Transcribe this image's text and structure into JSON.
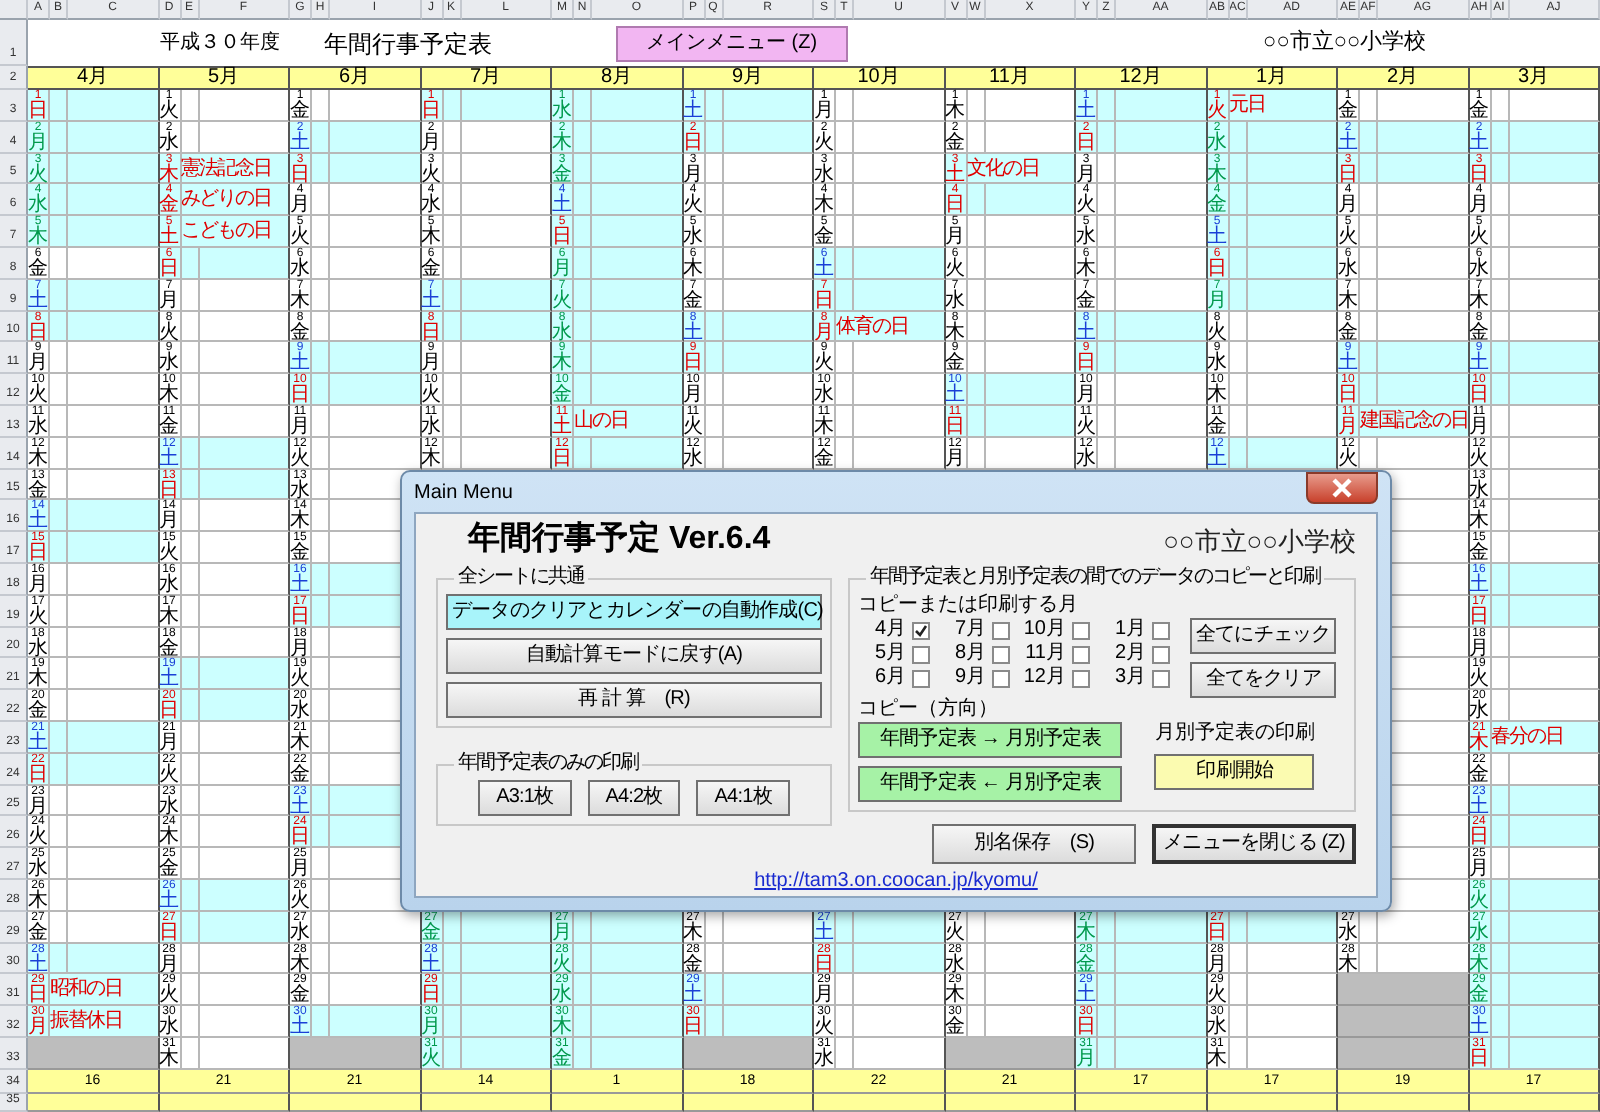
{
  "sheet": {
    "column_letters": [
      "A",
      "B",
      "C",
      "D",
      "E",
      "F",
      "G",
      "H",
      "I",
      "J",
      "K",
      "L",
      "M",
      "N",
      "O",
      "P",
      "Q",
      "R",
      "S",
      "T",
      "U",
      "V",
      "W",
      "X",
      "Y",
      "Z",
      "AA",
      "AB",
      "AC",
      "AD",
      "AE",
      "AF",
      "AG",
      "AH",
      "AI",
      "AJ"
    ],
    "row_numbers": [
      "1",
      "2",
      "3",
      "4",
      "5",
      "6",
      "7",
      "8",
      "9",
      "10",
      "11",
      "12",
      "13",
      "14",
      "15",
      "16",
      "17",
      "18",
      "19",
      "20",
      "21",
      "22",
      "23",
      "24",
      "25",
      "26",
      "27",
      "28",
      "29",
      "30",
      "31",
      "32",
      "33",
      "34",
      "35"
    ],
    "title_row": {
      "fiscal_year": "平成３０年度",
      "title": "年間行事予定表",
      "menu_button": "メインメニュー (Z)",
      "school": "○○市立○○小学校"
    },
    "months": [
      {
        "label": "4月",
        "total": "16",
        "days": [
          {
            "d": "1",
            "w": "日",
            "kind": "sun"
          },
          {
            "d": "2",
            "w": "月",
            "kind": "vac"
          },
          {
            "d": "3",
            "w": "火",
            "kind": "vac"
          },
          {
            "d": "4",
            "w": "水",
            "kind": "vac"
          },
          {
            "d": "5",
            "w": "木",
            "kind": "vac"
          },
          {
            "d": "6",
            "w": "金",
            "kind": "wd"
          },
          {
            "d": "7",
            "w": "土",
            "kind": "sat"
          },
          {
            "d": "8",
            "w": "日",
            "kind": "sun"
          },
          {
            "d": "9",
            "w": "月",
            "kind": "wd"
          },
          {
            "d": "10",
            "w": "火",
            "kind": "wd"
          },
          {
            "d": "11",
            "w": "水",
            "kind": "wd"
          },
          {
            "d": "12",
            "w": "木",
            "kind": "wd"
          },
          {
            "d": "13",
            "w": "金",
            "kind": "wd"
          },
          {
            "d": "14",
            "w": "土",
            "kind": "sat"
          },
          {
            "d": "15",
            "w": "日",
            "kind": "sun"
          },
          {
            "d": "16",
            "w": "月",
            "kind": "wd"
          },
          {
            "d": "17",
            "w": "火",
            "kind": "wd"
          },
          {
            "d": "18",
            "w": "水",
            "kind": "wd"
          },
          {
            "d": "19",
            "w": "木",
            "kind": "wd"
          },
          {
            "d": "20",
            "w": "金",
            "kind": "wd"
          },
          {
            "d": "21",
            "w": "土",
            "kind": "sat"
          },
          {
            "d": "22",
            "w": "日",
            "kind": "sun"
          },
          {
            "d": "23",
            "w": "月",
            "kind": "wd"
          },
          {
            "d": "24",
            "w": "火",
            "kind": "wd"
          },
          {
            "d": "25",
            "w": "水",
            "kind": "wd"
          },
          {
            "d": "26",
            "w": "木",
            "kind": "wd"
          },
          {
            "d": "27",
            "w": "金",
            "kind": "wd"
          },
          {
            "d": "28",
            "w": "土",
            "kind": "sat"
          },
          {
            "d": "29",
            "w": "日",
            "kind": "hol",
            "ev": "昭和の日"
          },
          {
            "d": "30",
            "w": "月",
            "kind": "hol",
            "ev": "振替休日"
          }
        ]
      },
      {
        "label": "5月",
        "total": "21",
        "days": [
          {
            "d": "1",
            "w": "火",
            "kind": "wd"
          },
          {
            "d": "2",
            "w": "水",
            "kind": "wd"
          },
          {
            "d": "3",
            "w": "木",
            "kind": "hol",
            "ev": "憲法記念日"
          },
          {
            "d": "4",
            "w": "金",
            "kind": "hol",
            "ev": "みどりの日"
          },
          {
            "d": "5",
            "w": "土",
            "kind": "hol",
            "ev": "こどもの日"
          },
          {
            "d": "6",
            "w": "日",
            "kind": "sun"
          },
          {
            "d": "7",
            "w": "月",
            "kind": "wd"
          },
          {
            "d": "8",
            "w": "火",
            "kind": "wd"
          },
          {
            "d": "9",
            "w": "水",
            "kind": "wd"
          },
          {
            "d": "10",
            "w": "木",
            "kind": "wd"
          },
          {
            "d": "11",
            "w": "金",
            "kind": "wd"
          },
          {
            "d": "12",
            "w": "土",
            "kind": "sat"
          },
          {
            "d": "13",
            "w": "日",
            "kind": "sun"
          },
          {
            "d": "14",
            "w": "月",
            "kind": "wd"
          },
          {
            "d": "15",
            "w": "火",
            "kind": "wd"
          },
          {
            "d": "16",
            "w": "水",
            "kind": "wd"
          },
          {
            "d": "17",
            "w": "木",
            "kind": "wd"
          },
          {
            "d": "18",
            "w": "金",
            "kind": "wd"
          },
          {
            "d": "19",
            "w": "土",
            "kind": "sat"
          },
          {
            "d": "20",
            "w": "日",
            "kind": "sun"
          },
          {
            "d": "21",
            "w": "月",
            "kind": "wd"
          },
          {
            "d": "22",
            "w": "火",
            "kind": "wd"
          },
          {
            "d": "23",
            "w": "水",
            "kind": "wd"
          },
          {
            "d": "24",
            "w": "木",
            "kind": "wd"
          },
          {
            "d": "25",
            "w": "金",
            "kind": "wd"
          },
          {
            "d": "26",
            "w": "土",
            "kind": "sat"
          },
          {
            "d": "27",
            "w": "日",
            "kind": "sun"
          },
          {
            "d": "28",
            "w": "月",
            "kind": "wd"
          },
          {
            "d": "29",
            "w": "火",
            "kind": "wd"
          },
          {
            "d": "30",
            "w": "水",
            "kind": "wd"
          },
          {
            "d": "31",
            "w": "木",
            "kind": "wd"
          }
        ]
      },
      {
        "label": "6月",
        "total": "21",
        "days": [
          {
            "d": "1",
            "w": "金",
            "kind": "wd"
          },
          {
            "d": "2",
            "w": "土",
            "kind": "sat"
          },
          {
            "d": "3",
            "w": "日",
            "kind": "sun"
          },
          {
            "d": "4",
            "w": "月",
            "kind": "wd"
          },
          {
            "d": "5",
            "w": "火",
            "kind": "wd"
          },
          {
            "d": "6",
            "w": "水",
            "kind": "wd"
          },
          {
            "d": "7",
            "w": "木",
            "kind": "wd"
          },
          {
            "d": "8",
            "w": "金",
            "kind": "wd"
          },
          {
            "d": "9",
            "w": "土",
            "kind": "sat"
          },
          {
            "d": "10",
            "w": "日",
            "kind": "sun"
          },
          {
            "d": "11",
            "w": "月",
            "kind": "wd"
          },
          {
            "d": "12",
            "w": "火",
            "kind": "wd"
          },
          {
            "d": "13",
            "w": "水",
            "kind": "wd"
          },
          {
            "d": "14",
            "w": "木",
            "kind": "wd"
          },
          {
            "d": "15",
            "w": "金",
            "kind": "wd"
          },
          {
            "d": "16",
            "w": "土",
            "kind": "sat"
          },
          {
            "d": "17",
            "w": "日",
            "kind": "sun"
          },
          {
            "d": "18",
            "w": "月",
            "kind": "wd"
          },
          {
            "d": "19",
            "w": "火",
            "kind": "wd"
          },
          {
            "d": "20",
            "w": "水",
            "kind": "wd"
          },
          {
            "d": "21",
            "w": "木",
            "kind": "wd"
          },
          {
            "d": "22",
            "w": "金",
            "kind": "wd"
          },
          {
            "d": "23",
            "w": "土",
            "kind": "sat"
          },
          {
            "d": "24",
            "w": "日",
            "kind": "sun"
          },
          {
            "d": "25",
            "w": "月",
            "kind": "wd"
          },
          {
            "d": "26",
            "w": "火",
            "kind": "wd"
          },
          {
            "d": "27",
            "w": "水",
            "kind": "wd"
          },
          {
            "d": "28",
            "w": "木",
            "kind": "wd"
          },
          {
            "d": "29",
            "w": "金",
            "kind": "wd"
          },
          {
            "d": "30",
            "w": "土",
            "kind": "sat"
          }
        ]
      },
      {
        "label": "7月",
        "total": "14",
        "days": [
          {
            "d": "1",
            "w": "日",
            "kind": "sun"
          },
          {
            "d": "2",
            "w": "月",
            "kind": "wd"
          },
          {
            "d": "3",
            "w": "火",
            "kind": "wd"
          },
          {
            "d": "4",
            "w": "水",
            "kind": "wd"
          },
          {
            "d": "5",
            "w": "木",
            "kind": "wd"
          },
          {
            "d": "6",
            "w": "金",
            "kind": "wd"
          },
          {
            "d": "7",
            "w": "土",
            "kind": "sat"
          },
          {
            "d": "8",
            "w": "日",
            "kind": "sun"
          },
          {
            "d": "9",
            "w": "月",
            "kind": "wd"
          },
          {
            "d": "10",
            "w": "火",
            "kind": "wd"
          },
          {
            "d": "11",
            "w": "水",
            "kind": "wd"
          },
          {
            "d": "12",
            "w": "木",
            "kind": "wd"
          }
        ],
        "days_after": [
          {
            "d": "27",
            "w": "金",
            "kind": "vac"
          },
          {
            "d": "28",
            "w": "土",
            "kind": "sat"
          },
          {
            "d": "29",
            "w": "日",
            "kind": "sun"
          },
          {
            "d": "30",
            "w": "月",
            "kind": "vac"
          },
          {
            "d": "31",
            "w": "火",
            "kind": "vac"
          }
        ]
      },
      {
        "label": "8月",
        "total": "1",
        "days": [
          {
            "d": "1",
            "w": "水",
            "kind": "vac"
          },
          {
            "d": "2",
            "w": "木",
            "kind": "vac"
          },
          {
            "d": "3",
            "w": "金",
            "kind": "vac"
          },
          {
            "d": "4",
            "w": "土",
            "kind": "sat"
          },
          {
            "d": "5",
            "w": "日",
            "kind": "sun"
          },
          {
            "d": "6",
            "w": "月",
            "kind": "vac"
          },
          {
            "d": "7",
            "w": "火",
            "kind": "vac"
          },
          {
            "d": "8",
            "w": "水",
            "kind": "vac"
          },
          {
            "d": "9",
            "w": "木",
            "kind": "vac"
          },
          {
            "d": "10",
            "w": "金",
            "kind": "vac"
          },
          {
            "d": "11",
            "w": "土",
            "kind": "hol",
            "ev": "山の日"
          },
          {
            "d": "12",
            "w": "日",
            "kind": "sun"
          }
        ],
        "days_after": [
          {
            "d": "27",
            "w": "月",
            "kind": "vac"
          },
          {
            "d": "28",
            "w": "火",
            "kind": "vac"
          },
          {
            "d": "29",
            "w": "水",
            "kind": "vac"
          },
          {
            "d": "30",
            "w": "木",
            "kind": "vac"
          },
          {
            "d": "31",
            "w": "金",
            "kind": "vac"
          }
        ]
      },
      {
        "label": "9月",
        "total": "18",
        "days": [
          {
            "d": "1",
            "w": "土",
            "kind": "sat"
          },
          {
            "d": "2",
            "w": "日",
            "kind": "sun"
          },
          {
            "d": "3",
            "w": "月",
            "kind": "wd"
          },
          {
            "d": "4",
            "w": "火",
            "kind": "wd"
          },
          {
            "d": "5",
            "w": "水",
            "kind": "wd"
          },
          {
            "d": "6",
            "w": "木",
            "kind": "wd"
          },
          {
            "d": "7",
            "w": "金",
            "kind": "wd"
          },
          {
            "d": "8",
            "w": "土",
            "kind": "sat"
          },
          {
            "d": "9",
            "w": "日",
            "kind": "sun"
          },
          {
            "d": "10",
            "w": "月",
            "kind": "wd"
          },
          {
            "d": "11",
            "w": "火",
            "kind": "wd"
          },
          {
            "d": "12",
            "w": "水",
            "kind": "wd"
          }
        ],
        "days_after": [
          {
            "d": "27",
            "w": "木",
            "kind": "wd"
          },
          {
            "d": "28",
            "w": "金",
            "kind": "wd"
          },
          {
            "d": "29",
            "w": "土",
            "kind": "sat"
          },
          {
            "d": "30",
            "w": "日",
            "kind": "sun"
          }
        ]
      },
      {
        "label": "10月",
        "total": "22",
        "days": [
          {
            "d": "1",
            "w": "月",
            "kind": "wd"
          },
          {
            "d": "2",
            "w": "火",
            "kind": "wd"
          },
          {
            "d": "3",
            "w": "水",
            "kind": "wd"
          },
          {
            "d": "4",
            "w": "木",
            "kind": "wd"
          },
          {
            "d": "5",
            "w": "金",
            "kind": "wd"
          },
          {
            "d": "6",
            "w": "土",
            "kind": "sat"
          },
          {
            "d": "7",
            "w": "日",
            "kind": "sun"
          },
          {
            "d": "8",
            "w": "月",
            "kind": "hol",
            "ev": "体育の日"
          },
          {
            "d": "9",
            "w": "火",
            "kind": "wd"
          },
          {
            "d": "10",
            "w": "水",
            "kind": "wd"
          },
          {
            "d": "11",
            "w": "木",
            "kind": "wd"
          },
          {
            "d": "12",
            "w": "金",
            "kind": "wd"
          }
        ],
        "days_after": [
          {
            "d": "27",
            "w": "土",
            "kind": "sat"
          },
          {
            "d": "28",
            "w": "日",
            "kind": "sun"
          },
          {
            "d": "29",
            "w": "月",
            "kind": "wd"
          },
          {
            "d": "30",
            "w": "火",
            "kind": "wd"
          },
          {
            "d": "31",
            "w": "水",
            "kind": "wd"
          }
        ]
      },
      {
        "label": "11月",
        "total": "21",
        "days": [
          {
            "d": "1",
            "w": "木",
            "kind": "wd"
          },
          {
            "d": "2",
            "w": "金",
            "kind": "wd"
          },
          {
            "d": "3",
            "w": "土",
            "kind": "hol",
            "ev": "文化の日"
          },
          {
            "d": "4",
            "w": "日",
            "kind": "sun"
          },
          {
            "d": "5",
            "w": "月",
            "kind": "wd"
          },
          {
            "d": "6",
            "w": "火",
            "kind": "wd"
          },
          {
            "d": "7",
            "w": "水",
            "kind": "wd"
          },
          {
            "d": "8",
            "w": "木",
            "kind": "wd"
          },
          {
            "d": "9",
            "w": "金",
            "kind": "wd"
          },
          {
            "d": "10",
            "w": "土",
            "kind": "sat"
          },
          {
            "d": "11",
            "w": "日",
            "kind": "sun"
          },
          {
            "d": "12",
            "w": "月",
            "kind": "wd"
          }
        ],
        "days_after": [
          {
            "d": "27",
            "w": "火",
            "kind": "wd"
          },
          {
            "d": "28",
            "w": "水",
            "kind": "wd"
          },
          {
            "d": "29",
            "w": "木",
            "kind": "wd"
          },
          {
            "d": "30",
            "w": "金",
            "kind": "wd"
          }
        ]
      },
      {
        "label": "12月",
        "total": "17",
        "days": [
          {
            "d": "1",
            "w": "土",
            "kind": "sat"
          },
          {
            "d": "2",
            "w": "日",
            "kind": "sun"
          },
          {
            "d": "3",
            "w": "月",
            "kind": "wd"
          },
          {
            "d": "4",
            "w": "火",
            "kind": "wd"
          },
          {
            "d": "5",
            "w": "水",
            "kind": "wd"
          },
          {
            "d": "6",
            "w": "木",
            "kind": "wd"
          },
          {
            "d": "7",
            "w": "金",
            "kind": "wd"
          },
          {
            "d": "8",
            "w": "土",
            "kind": "sat"
          },
          {
            "d": "9",
            "w": "日",
            "kind": "sun"
          },
          {
            "d": "10",
            "w": "月",
            "kind": "wd"
          },
          {
            "d": "11",
            "w": "火",
            "kind": "wd"
          },
          {
            "d": "12",
            "w": "水",
            "kind": "wd"
          }
        ],
        "days_after": [
          {
            "d": "27",
            "w": "木",
            "kind": "vac"
          },
          {
            "d": "28",
            "w": "金",
            "kind": "vac"
          },
          {
            "d": "29",
            "w": "土",
            "kind": "sat"
          },
          {
            "d": "30",
            "w": "日",
            "kind": "sun"
          },
          {
            "d": "31",
            "w": "月",
            "kind": "vac"
          }
        ]
      },
      {
        "label": "1月",
        "total": "17",
        "days": [
          {
            "d": "1",
            "w": "火",
            "kind": "hol",
            "ev": "元日"
          },
          {
            "d": "2",
            "w": "水",
            "kind": "vac"
          },
          {
            "d": "3",
            "w": "木",
            "kind": "vac"
          },
          {
            "d": "4",
            "w": "金",
            "kind": "vac"
          },
          {
            "d": "5",
            "w": "土",
            "kind": "sat"
          },
          {
            "d": "6",
            "w": "日",
            "kind": "sun"
          },
          {
            "d": "7",
            "w": "月",
            "kind": "vac"
          },
          {
            "d": "8",
            "w": "火",
            "kind": "wd"
          },
          {
            "d": "9",
            "w": "水",
            "kind": "wd"
          },
          {
            "d": "10",
            "w": "木",
            "kind": "wd"
          },
          {
            "d": "11",
            "w": "金",
            "kind": "wd"
          },
          {
            "d": "12",
            "w": "土",
            "kind": "sat"
          }
        ],
        "days_after": [
          {
            "d": "27",
            "w": "日",
            "kind": "sun"
          },
          {
            "d": "28",
            "w": "月",
            "kind": "wd"
          },
          {
            "d": "29",
            "w": "火",
            "kind": "wd"
          },
          {
            "d": "30",
            "w": "水",
            "kind": "wd"
          },
          {
            "d": "31",
            "w": "木",
            "kind": "wd"
          }
        ]
      },
      {
        "label": "2月",
        "total": "19",
        "days": [
          {
            "d": "1",
            "w": "金",
            "kind": "wd"
          },
          {
            "d": "2",
            "w": "土",
            "kind": "sat"
          },
          {
            "d": "3",
            "w": "日",
            "kind": "sun"
          },
          {
            "d": "4",
            "w": "月",
            "kind": "wd"
          },
          {
            "d": "5",
            "w": "火",
            "kind": "wd"
          },
          {
            "d": "6",
            "w": "水",
            "kind": "wd"
          },
          {
            "d": "7",
            "w": "木",
            "kind": "wd"
          },
          {
            "d": "8",
            "w": "金",
            "kind": "wd"
          },
          {
            "d": "9",
            "w": "土",
            "kind": "sat"
          },
          {
            "d": "10",
            "w": "日",
            "kind": "sun"
          },
          {
            "d": "11",
            "w": "月",
            "kind": "hol",
            "ev": "建国記念の日"
          },
          {
            "d": "12",
            "w": "火",
            "kind": "wd"
          }
        ],
        "days_after": [
          {
            "d": "27",
            "w": "水",
            "kind": "wd"
          },
          {
            "d": "28",
            "w": "木",
            "kind": "wd"
          }
        ]
      },
      {
        "label": "3月",
        "total": "17",
        "days": [
          {
            "d": "1",
            "w": "金",
            "kind": "wd"
          },
          {
            "d": "2",
            "w": "土",
            "kind": "sat"
          },
          {
            "d": "3",
            "w": "日",
            "kind": "sun"
          },
          {
            "d": "4",
            "w": "月",
            "kind": "wd"
          },
          {
            "d": "5",
            "w": "火",
            "kind": "wd"
          },
          {
            "d": "6",
            "w": "水",
            "kind": "wd"
          },
          {
            "d": "7",
            "w": "木",
            "kind": "wd"
          },
          {
            "d": "8",
            "w": "金",
            "kind": "wd"
          },
          {
            "d": "9",
            "w": "土",
            "kind": "sat"
          },
          {
            "d": "10",
            "w": "日",
            "kind": "sun"
          },
          {
            "d": "11",
            "w": "月",
            "kind": "wd"
          },
          {
            "d": "12",
            "w": "火",
            "kind": "wd"
          },
          {
            "d": "13",
            "w": "水",
            "kind": "wd"
          },
          {
            "d": "14",
            "w": "木",
            "kind": "wd"
          },
          {
            "d": "15",
            "w": "金",
            "kind": "wd"
          },
          {
            "d": "16",
            "w": "土",
            "kind": "sat"
          },
          {
            "d": "17",
            "w": "日",
            "kind": "sun"
          },
          {
            "d": "18",
            "w": "月",
            "kind": "wd"
          },
          {
            "d": "19",
            "w": "火",
            "kind": "wd"
          },
          {
            "d": "20",
            "w": "水",
            "kind": "wd"
          },
          {
            "d": "21",
            "w": "木",
            "kind": "hol",
            "ev": "春分の日"
          },
          {
            "d": "22",
            "w": "金",
            "kind": "wd"
          },
          {
            "d": "23",
            "w": "土",
            "kind": "sat"
          },
          {
            "d": "24",
            "w": "日",
            "kind": "sun"
          },
          {
            "d": "25",
            "w": "月",
            "kind": "wd"
          },
          {
            "d": "26",
            "w": "火",
            "kind": "vac"
          },
          {
            "d": "27",
            "w": "水",
            "kind": "vac"
          },
          {
            "d": "28",
            "w": "木",
            "kind": "vac"
          },
          {
            "d": "29",
            "w": "金",
            "kind": "vac"
          },
          {
            "d": "30",
            "w": "土",
            "kind": "sat"
          },
          {
            "d": "31",
            "w": "日",
            "kind": "sun"
          }
        ]
      }
    ]
  },
  "dialog": {
    "title": "Main Menu",
    "heading": "年間行事予定 Ver.6.4",
    "school": "○○市立○○小学校",
    "common_group": {
      "legend": "全シートに共通",
      "buttons": [
        {
          "label": "データのクリアとカレンダーの自動作成(C)",
          "kind": "cyan"
        },
        {
          "label": "自動計算モードに戻す(A)",
          "kind": "plain"
        },
        {
          "label": "再 計 算　(R)",
          "kind": "plain"
        }
      ]
    },
    "print_group": {
      "legend": "年間予定表のみの印刷",
      "buttons": [
        "A3:1枚",
        "A4:2枚",
        "A4:1枚"
      ]
    },
    "copy_group": {
      "legend": "年間予定表と月別予定表の間でのデータのコピーと印刷",
      "months_label": "コピーまたは印刷する月",
      "months": [
        {
          "label": "4月",
          "checked": true
        },
        {
          "label": "5月",
          "checked": false
        },
        {
          "label": "6月",
          "checked": false
        },
        {
          "label": "7月",
          "checked": false
        },
        {
          "label": "8月",
          "checked": false
        },
        {
          "label": "9月",
          "checked": false
        },
        {
          "label": "10月",
          "checked": false
        },
        {
          "label": "11月",
          "checked": false
        },
        {
          "label": "12月",
          "checked": false
        },
        {
          "label": "1月",
          "checked": false
        },
        {
          "label": "2月",
          "checked": false
        },
        {
          "label": "3月",
          "checked": false
        }
      ],
      "check_all": "全てにチェック",
      "clear_all": "全てをクリア",
      "direction_label": "コピー（方向）",
      "copy_buttons": [
        "年間予定表 → 月別予定表",
        "年間予定表 ← 月別予定表"
      ],
      "print_label": "月別予定表の印刷",
      "print_button": "印刷開始"
    },
    "bottom_buttons": [
      {
        "label": "別名保存　(S)",
        "focused": false
      },
      {
        "label": "メニューを閉じる (Z)",
        "focused": true
      }
    ],
    "link": "http://tam3.on.coocan.jp/kyomu/"
  }
}
